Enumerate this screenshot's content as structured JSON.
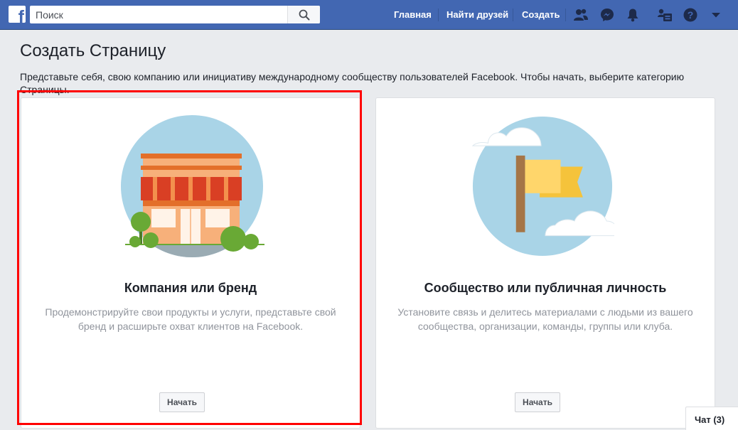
{
  "topbar": {
    "logo": "f",
    "search": {
      "placeholder": "Поиск",
      "value": ""
    },
    "nav": {
      "home": "Главная",
      "find_friends": "Найти друзей",
      "create": "Создать"
    },
    "icons": [
      "friend-requests-icon",
      "messenger-icon",
      "notifications-icon",
      "page-admin-icon",
      "help-icon",
      "dropdown-arrow-icon"
    ]
  },
  "page": {
    "title": "Создать Страницу",
    "intro": "Представьте себя, свою компанию или инициативу международному сообществу пользователей Facebook. Чтобы начать, выберите категорию Страницы."
  },
  "cards": [
    {
      "title": "Компания или бренд",
      "description": "Продемонстрируйте свои продукты и услуги, представьте свой бренд и расширьте охват клиентов на Facebook.",
      "button": "Начать",
      "illustration": "storefront"
    },
    {
      "title": "Сообщество или публичная личность",
      "description": "Установите связь и делитесь материалами с людьми из вашего сообщества, организации, команды, группы или клуба.",
      "button": "Начать",
      "illustration": "flag"
    }
  ],
  "chat": {
    "label": "Чат (3)"
  },
  "colors": {
    "brand": "#4267b2",
    "highlight": "#ff0000",
    "circle": "#a9d4e7"
  }
}
